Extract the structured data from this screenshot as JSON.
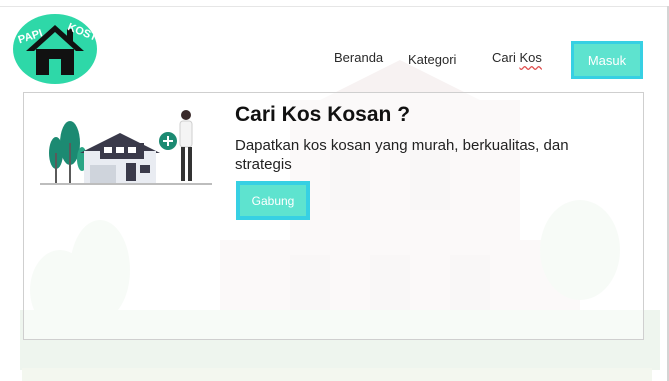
{
  "logo": {
    "text_left": "PAPI",
    "text_right": "KOST"
  },
  "nav": {
    "beranda": "Beranda",
    "kategori": "Kategori",
    "cari": "Cari",
    "kos": "Kos",
    "masuk": "Masuk"
  },
  "hero": {
    "title": "Cari Kos Kosan ?",
    "subtitle": "Dapatkan kos kosan yang murah, berkualitas, dan strategis",
    "join": "Gabung"
  },
  "colors": {
    "accent": "#5ee3cf",
    "accent_border": "#37d0e3",
    "logo_bg": "#2ed8a8",
    "illustration_green": "#1c8a72"
  }
}
